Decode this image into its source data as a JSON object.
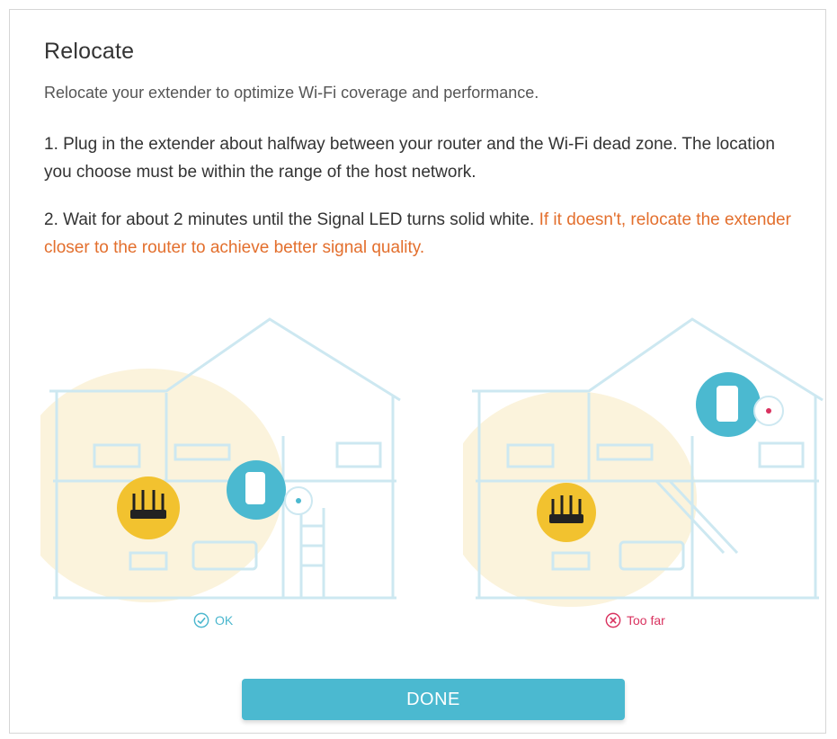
{
  "dialog": {
    "title": "Relocate",
    "subtitle": "Relocate your extender to optimize Wi-Fi coverage and performance.",
    "step1": "1. Plug in the extender about halfway between your router and the Wi-Fi dead zone. The location you choose must be within the range of the host network.",
    "step2_part1": "2. Wait for about 2 minutes until the Signal LED turns solid white. ",
    "step2_part2": "If it doesn't, relocate the extender closer to the router to achieve better signal quality.",
    "caption_ok": "OK",
    "caption_far": "Too far",
    "done_label": "DONE"
  },
  "icons": {
    "ok": "check-circle-icon",
    "far": "x-circle-icon",
    "router": "router-icon",
    "extender": "extender-icon"
  },
  "colors": {
    "accent": "#4bb9d0",
    "ok": "#4bb7ce",
    "far": "#d9325f",
    "router_circle": "#f2c22f",
    "house_line": "#cde8f1",
    "coverage": "#fbf3dc",
    "warning_text": "#e36f2d"
  }
}
